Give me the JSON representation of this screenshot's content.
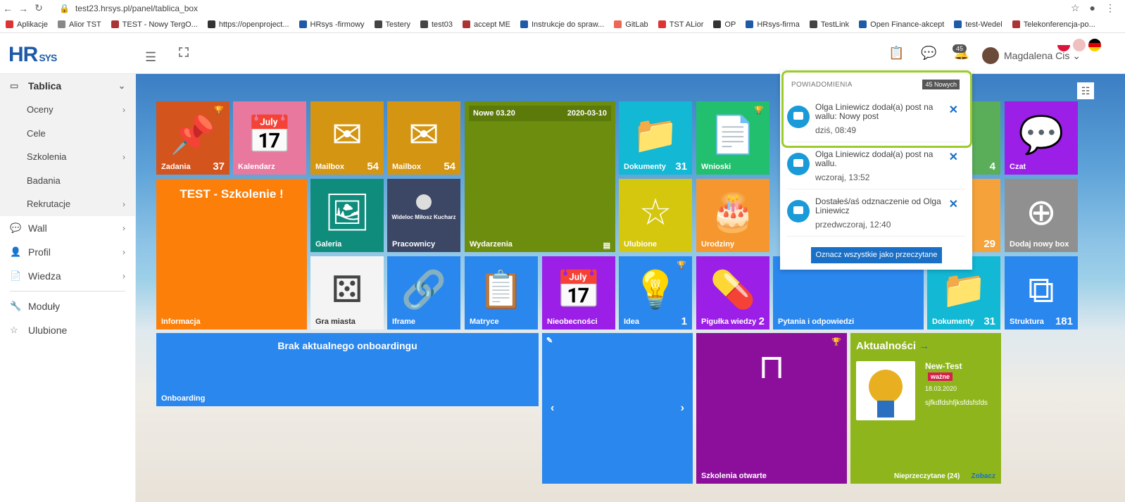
{
  "browser": {
    "url": "test23.hrsys.pl/panel/tablica_box",
    "bookmarks": [
      "Aplikacje",
      "Alior TST",
      "TEST - Nowy TergO...",
      "https://openproject...",
      "HRsys -firmowy",
      "Testery",
      "test03",
      "accept ME",
      "Instrukcje do spraw...",
      "GitLab",
      "TST ALior",
      "OP",
      "HRsys-firma",
      "TestLink",
      "Open Finance-akcept",
      "test-Wedel",
      "Telekonferencja-po..."
    ]
  },
  "header": {
    "logo": "HR",
    "logo_sub": "SYS",
    "bell_badge": "45",
    "user_name": "Magdalena Cis"
  },
  "sidebar": {
    "active": "Tablica",
    "subitems": [
      "Oceny",
      "Cele",
      "Szkolenia",
      "Badania",
      "Rekrutacje"
    ],
    "items": [
      "Wall",
      "Profil",
      "Wiedza"
    ],
    "items2": [
      "Moduły",
      "Ulubione"
    ]
  },
  "tiles": {
    "zadania": {
      "label": "Zadania",
      "count": "37"
    },
    "kalendarz": {
      "label": "Kalendarz"
    },
    "mailbox1": {
      "label": "Mailbox",
      "count": "54"
    },
    "mailbox2": {
      "label": "Mailbox",
      "count": "54"
    },
    "wydarzenia": {
      "label": "Wydarzenia",
      "head_left": "Nowe 03.20",
      "head_right": "2020-03-10"
    },
    "dokumenty1": {
      "label": "Dokumenty",
      "count": "31"
    },
    "wnioski": {
      "label": "Wnioski"
    },
    "hidden4": {
      "count": "4"
    },
    "czat": {
      "label": "Czat"
    },
    "informacja": {
      "label": "Informacja",
      "title": "TEST - Szkolenie !"
    },
    "galeria": {
      "label": "Galeria"
    },
    "pracownicy": {
      "label": "Pracownicy",
      "person": "Wideloc Miłosz Kucharz"
    },
    "ulubione": {
      "label": "Ulubione"
    },
    "urodziny": {
      "label": "Urodziny"
    },
    "hidden29": {
      "count": "29"
    },
    "dodaj": {
      "label": "Dodaj nowy box"
    },
    "gra": {
      "label": "Gra miasta"
    },
    "iframe": {
      "label": "Iframe"
    },
    "matryce": {
      "label": "Matryce"
    },
    "nieobecnosci": {
      "label": "Nieobecności"
    },
    "idea": {
      "label": "Idea",
      "count": "1"
    },
    "pigulka": {
      "label": "Pigułka wiedzy",
      "count": "2"
    },
    "pytania": {
      "label": "Pytania i odpowiedzi"
    },
    "dokumenty2": {
      "label": "Dokumenty",
      "count": "31"
    },
    "struktura": {
      "label": "Struktura",
      "count": "181"
    },
    "onboarding": {
      "label": "Onboarding",
      "title": "Brak aktualnego onboardingu"
    },
    "szkolenia": {
      "label": "Szkolenia otwarte"
    },
    "aktualnosci": {
      "title": "Aktualności",
      "news_title": "New-Test",
      "tag": "ważne",
      "date": "18.03.2020",
      "text": "sjfkdfdshfjksfdsfsfds",
      "unread": "Nieprzeczytane (24)",
      "more": "Zobacz"
    }
  },
  "notifications": {
    "header": "POWIADOMIENIA",
    "new_badge": "45 Nowych",
    "items": [
      {
        "text": "Olga Liniewicz dodał(a) post na wallu: Nowy post",
        "time": "dziś, 08:49"
      },
      {
        "text": "Olga Liniewicz dodał(a) post na wallu.",
        "time": "wczoraj, 13:52"
      },
      {
        "text": "Dostałeś/aś odznaczenie od Olga Liniewicz",
        "time": "przedwczoraj, 12:40"
      }
    ],
    "mark_all": "Oznacz wszystkie jako przeczytane"
  }
}
